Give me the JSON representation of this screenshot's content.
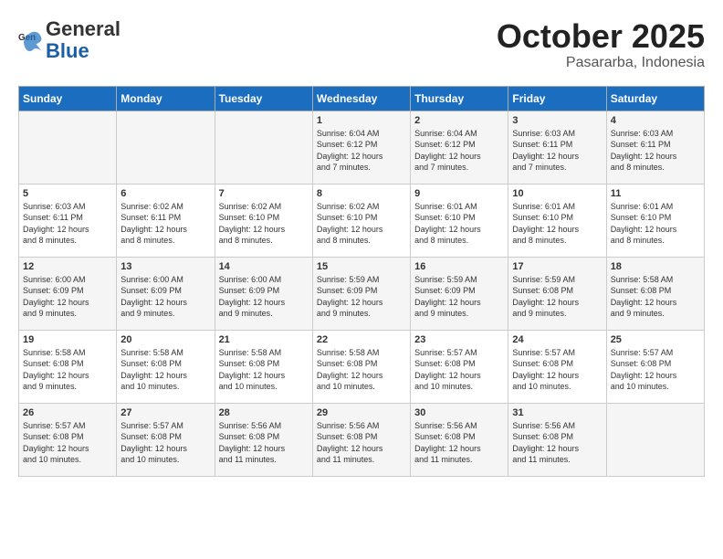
{
  "header": {
    "logo_line1": "General",
    "logo_line2": "Blue",
    "month": "October 2025",
    "location": "Pasararba, Indonesia"
  },
  "weekdays": [
    "Sunday",
    "Monday",
    "Tuesday",
    "Wednesday",
    "Thursday",
    "Friday",
    "Saturday"
  ],
  "weeks": [
    [
      {
        "day": "",
        "info": ""
      },
      {
        "day": "",
        "info": ""
      },
      {
        "day": "",
        "info": ""
      },
      {
        "day": "1",
        "info": "Sunrise: 6:04 AM\nSunset: 6:12 PM\nDaylight: 12 hours\nand 7 minutes."
      },
      {
        "day": "2",
        "info": "Sunrise: 6:04 AM\nSunset: 6:12 PM\nDaylight: 12 hours\nand 7 minutes."
      },
      {
        "day": "3",
        "info": "Sunrise: 6:03 AM\nSunset: 6:11 PM\nDaylight: 12 hours\nand 7 minutes."
      },
      {
        "day": "4",
        "info": "Sunrise: 6:03 AM\nSunset: 6:11 PM\nDaylight: 12 hours\nand 8 minutes."
      }
    ],
    [
      {
        "day": "5",
        "info": "Sunrise: 6:03 AM\nSunset: 6:11 PM\nDaylight: 12 hours\nand 8 minutes."
      },
      {
        "day": "6",
        "info": "Sunrise: 6:02 AM\nSunset: 6:11 PM\nDaylight: 12 hours\nand 8 minutes."
      },
      {
        "day": "7",
        "info": "Sunrise: 6:02 AM\nSunset: 6:10 PM\nDaylight: 12 hours\nand 8 minutes."
      },
      {
        "day": "8",
        "info": "Sunrise: 6:02 AM\nSunset: 6:10 PM\nDaylight: 12 hours\nand 8 minutes."
      },
      {
        "day": "9",
        "info": "Sunrise: 6:01 AM\nSunset: 6:10 PM\nDaylight: 12 hours\nand 8 minutes."
      },
      {
        "day": "10",
        "info": "Sunrise: 6:01 AM\nSunset: 6:10 PM\nDaylight: 12 hours\nand 8 minutes."
      },
      {
        "day": "11",
        "info": "Sunrise: 6:01 AM\nSunset: 6:10 PM\nDaylight: 12 hours\nand 8 minutes."
      }
    ],
    [
      {
        "day": "12",
        "info": "Sunrise: 6:00 AM\nSunset: 6:09 PM\nDaylight: 12 hours\nand 9 minutes."
      },
      {
        "day": "13",
        "info": "Sunrise: 6:00 AM\nSunset: 6:09 PM\nDaylight: 12 hours\nand 9 minutes."
      },
      {
        "day": "14",
        "info": "Sunrise: 6:00 AM\nSunset: 6:09 PM\nDaylight: 12 hours\nand 9 minutes."
      },
      {
        "day": "15",
        "info": "Sunrise: 5:59 AM\nSunset: 6:09 PM\nDaylight: 12 hours\nand 9 minutes."
      },
      {
        "day": "16",
        "info": "Sunrise: 5:59 AM\nSunset: 6:09 PM\nDaylight: 12 hours\nand 9 minutes."
      },
      {
        "day": "17",
        "info": "Sunrise: 5:59 AM\nSunset: 6:08 PM\nDaylight: 12 hours\nand 9 minutes."
      },
      {
        "day": "18",
        "info": "Sunrise: 5:58 AM\nSunset: 6:08 PM\nDaylight: 12 hours\nand 9 minutes."
      }
    ],
    [
      {
        "day": "19",
        "info": "Sunrise: 5:58 AM\nSunset: 6:08 PM\nDaylight: 12 hours\nand 9 minutes."
      },
      {
        "day": "20",
        "info": "Sunrise: 5:58 AM\nSunset: 6:08 PM\nDaylight: 12 hours\nand 10 minutes."
      },
      {
        "day": "21",
        "info": "Sunrise: 5:58 AM\nSunset: 6:08 PM\nDaylight: 12 hours\nand 10 minutes."
      },
      {
        "day": "22",
        "info": "Sunrise: 5:58 AM\nSunset: 6:08 PM\nDaylight: 12 hours\nand 10 minutes."
      },
      {
        "day": "23",
        "info": "Sunrise: 5:57 AM\nSunset: 6:08 PM\nDaylight: 12 hours\nand 10 minutes."
      },
      {
        "day": "24",
        "info": "Sunrise: 5:57 AM\nSunset: 6:08 PM\nDaylight: 12 hours\nand 10 minutes."
      },
      {
        "day": "25",
        "info": "Sunrise: 5:57 AM\nSunset: 6:08 PM\nDaylight: 12 hours\nand 10 minutes."
      }
    ],
    [
      {
        "day": "26",
        "info": "Sunrise: 5:57 AM\nSunset: 6:08 PM\nDaylight: 12 hours\nand 10 minutes."
      },
      {
        "day": "27",
        "info": "Sunrise: 5:57 AM\nSunset: 6:08 PM\nDaylight: 12 hours\nand 10 minutes."
      },
      {
        "day": "28",
        "info": "Sunrise: 5:56 AM\nSunset: 6:08 PM\nDaylight: 12 hours\nand 11 minutes."
      },
      {
        "day": "29",
        "info": "Sunrise: 5:56 AM\nSunset: 6:08 PM\nDaylight: 12 hours\nand 11 minutes."
      },
      {
        "day": "30",
        "info": "Sunrise: 5:56 AM\nSunset: 6:08 PM\nDaylight: 12 hours\nand 11 minutes."
      },
      {
        "day": "31",
        "info": "Sunrise: 5:56 AM\nSunset: 6:08 PM\nDaylight: 12 hours\nand 11 minutes."
      },
      {
        "day": "",
        "info": ""
      }
    ]
  ]
}
